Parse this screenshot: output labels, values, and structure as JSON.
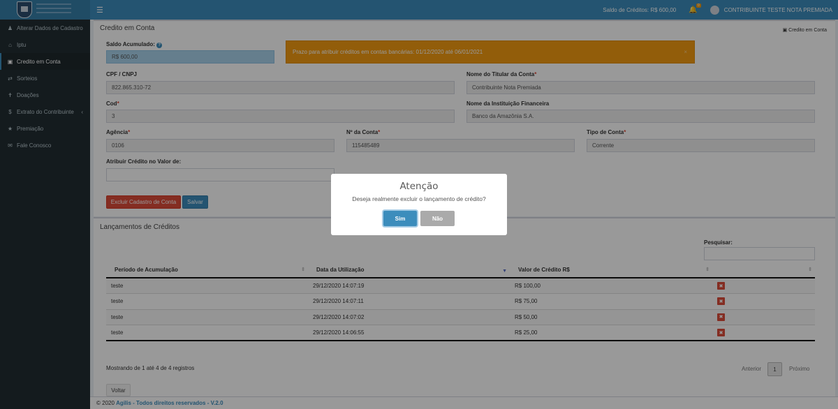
{
  "header": {
    "saldo": "Saldo de Créditos: R$ 600,00",
    "notif_count": "0",
    "user_name": "CONTRIBUINTE TESTE NOTA PREMIADA",
    "accent": "#3c8dbc"
  },
  "sidebar": {
    "items": [
      {
        "label": "Alterar Dados de Cadastro",
        "icon": "user-icon"
      },
      {
        "label": "Iptu",
        "icon": "home-icon"
      },
      {
        "label": "Credito em Conta",
        "icon": "money-icon"
      },
      {
        "label": "Sorteios",
        "icon": "random-icon"
      },
      {
        "label": "Doações",
        "icon": "gift-icon"
      },
      {
        "label": "Extrato do Contribuinte",
        "icon": "dollar-icon"
      },
      {
        "label": "Premiação",
        "icon": "trophy-icon"
      },
      {
        "label": "Fale Conosco",
        "icon": "comments-icon"
      }
    ]
  },
  "credito": {
    "title": "Credito em Conta",
    "breadcrumb": "Credito em Conta",
    "saldo_label": "Saldo Acumulado:",
    "saldo_value": "R$ 600,00",
    "alert": "Prazo para atribuir créditos em contas bancárias: 01/12/2020 até 06/01/2021",
    "cpf_label": "CPF / CNPJ",
    "cpf_value": "822.865.310-72",
    "titular_label": "Nome do Titular da Conta",
    "titular_value": "Contribuinte Nota Premiada",
    "cod_label": "Cod",
    "cod_value": "3",
    "instituicao_label": "Nome da Instituição Financeira",
    "instituicao_value": "Banco da Amazônia S.A.",
    "agencia_label": "Agência",
    "agencia_value": "0106",
    "conta_label": "Nº da Conta",
    "conta_value": "115485489",
    "tipo_label": "Tipo de Conta",
    "tipo_value": "Corrente",
    "atribuir_label": "Atribuir Crédito no Valor de:",
    "atribuir_value": "",
    "excluir_button": "Excluir Cadastro de Conta",
    "salvar_button": "Salvar"
  },
  "lancamentos": {
    "title": "Lançamentos de Créditos",
    "search_label": "Pesquisar:",
    "columns": [
      "Período de Acumulação",
      "Data da Utilização",
      "Valor de Crédito R$",
      ""
    ],
    "rows": [
      {
        "periodo": "teste",
        "data": "29/12/2020 14:07:19",
        "valor": "R$ 100,00"
      },
      {
        "periodo": "teste",
        "data": "29/12/2020 14:07:11",
        "valor": "R$ 75,00"
      },
      {
        "periodo": "teste",
        "data": "29/12/2020 14:07:02",
        "valor": "R$ 50,00"
      },
      {
        "periodo": "teste",
        "data": "29/12/2020 14:06:55",
        "valor": "R$ 25,00"
      }
    ],
    "info": "Mostrando de 1 até 4 de 4 registros",
    "prev": "Anterior",
    "page": "1",
    "next": "Próximo",
    "voltar": "Voltar"
  },
  "modal": {
    "title": "Atenção",
    "text": "Deseja realmente excluir o lançamento de crédito?",
    "yes": "Sim",
    "no": "Não"
  },
  "footer": {
    "year": "© 2020",
    "company": "Agilis - Todos direitos reservados - V.2.0"
  }
}
